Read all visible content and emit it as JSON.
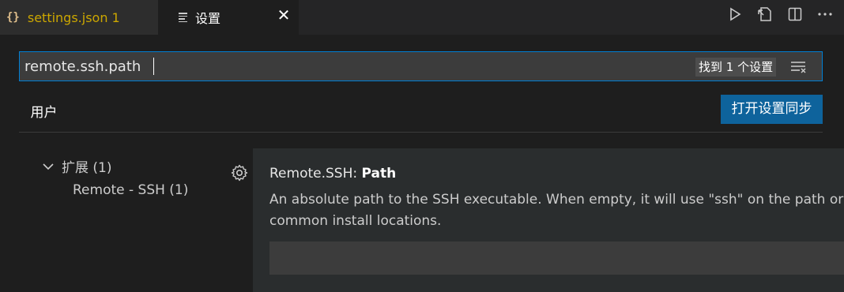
{
  "tabs": [
    {
      "label": "settings.json 1",
      "icon": "json-braces-icon",
      "color": "#cca700"
    },
    {
      "label": "设置",
      "icon": "settings-lines-icon",
      "active": true
    }
  ],
  "editor_actions": [
    "run-icon",
    "open-settings-json-icon",
    "split-editor-icon",
    "more-actions-icon"
  ],
  "search": {
    "value": "remote.ssh.path",
    "result_count": "找到 1 个设置"
  },
  "scope": {
    "user_tab": "用户",
    "sync_button": "打开设置同步"
  },
  "toc": {
    "group": "扩展 (1)",
    "item": "Remote - SSH (1)"
  },
  "setting": {
    "category": "Remote.SSH: ",
    "name": "Path",
    "description": "An absolute path to the SSH executable. When empty, it will use \"ssh\" on the path or in common install locations.",
    "value": ""
  },
  "colors": {
    "accent": "#007fd4",
    "button": "#0e639c",
    "warning_tab": "#cca700"
  }
}
